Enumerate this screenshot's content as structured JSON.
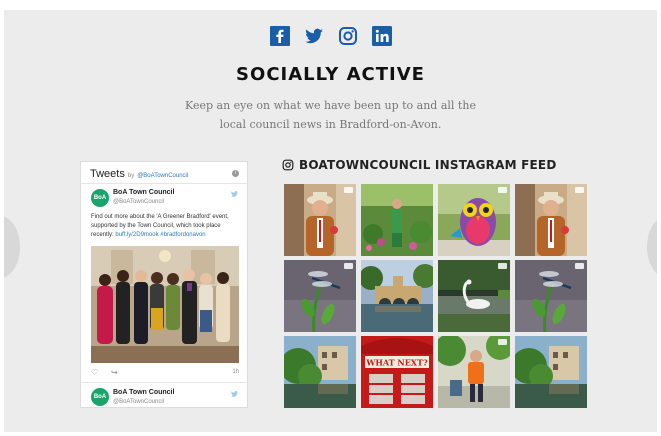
{
  "social": {
    "icons": [
      {
        "name": "facebook-icon",
        "color": "#1a5ea8"
      },
      {
        "name": "twitter-icon",
        "color": "#1a5ea8"
      },
      {
        "name": "instagram-icon",
        "color": "#1a5ea8"
      },
      {
        "name": "linkedin-icon",
        "color": "#1a5ea8"
      }
    ],
    "title": "SOCIALLY ACTIVE",
    "description": "Keep an eye on what we have been up to and all the local council news in Bradford-on-Avon."
  },
  "twitter": {
    "header_title": "Tweets",
    "header_by": "by",
    "header_handle": "@BoATownCouncil",
    "tweet": {
      "avatar_text": "BoA",
      "name": "BoA Town Council",
      "handle": "@BoATownCouncil",
      "text": "Find out more about the 'A Greener Bradford' event, supported by the Town Council, which took place recently:",
      "link": "buff.ly/2D9mook #bradfordonavon",
      "time": "1h"
    },
    "next_tweet": {
      "avatar_text": "BoA",
      "name": "BoA Town Council",
      "handle": "@BoATownCouncil"
    },
    "accent": "#2b7bb9"
  },
  "instagram": {
    "title": "BOATOWNCOUNCIL INSTAGRAM FEED",
    "tiles": [
      {
        "name": "instagram-post-mayor"
      },
      {
        "name": "instagram-post-garden"
      },
      {
        "name": "instagram-post-owl-sculpture"
      },
      {
        "name": "instagram-post-mayor"
      },
      {
        "name": "instagram-post-dragonfly"
      },
      {
        "name": "instagram-post-town-bridge"
      },
      {
        "name": "instagram-post-swan"
      },
      {
        "name": "instagram-post-dragonfly"
      },
      {
        "name": "instagram-post-river-houses"
      },
      {
        "name": "instagram-post-phone-box"
      },
      {
        "name": "instagram-post-worker"
      },
      {
        "name": "instagram-post-river-houses"
      }
    ],
    "phone_box_sign": "WHAT NEXT?"
  }
}
